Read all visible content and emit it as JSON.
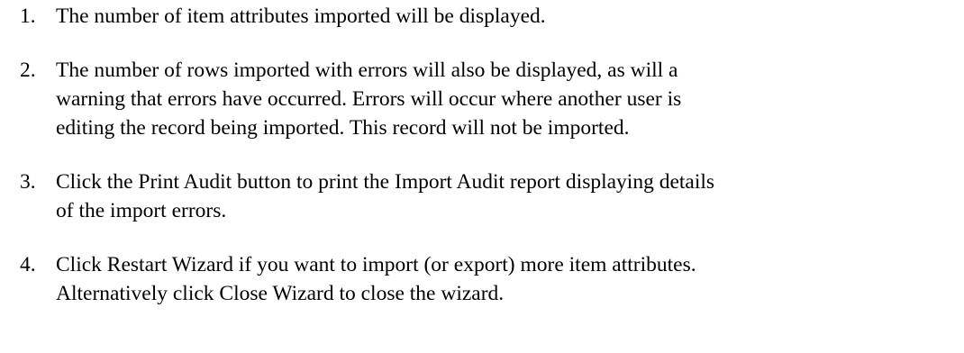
{
  "document": {
    "steps": [
      {
        "number": "1.",
        "text": "The number of item attributes imported will be displayed."
      },
      {
        "number": "2.",
        "text": "The number of rows imported with errors will also be displayed, as will a\nwarning that errors have occurred. Errors will occur where another user is\nediting the record being imported. This record will not be imported."
      },
      {
        "number": "3.",
        "text": "Click the Print Audit button to print the Import Audit report displaying details\nof the import errors."
      },
      {
        "number": "4.",
        "text": "Click Restart Wizard if you want to import (or export) more item attributes.\nAlternatively click Close Wizard to close the wizard."
      }
    ]
  }
}
